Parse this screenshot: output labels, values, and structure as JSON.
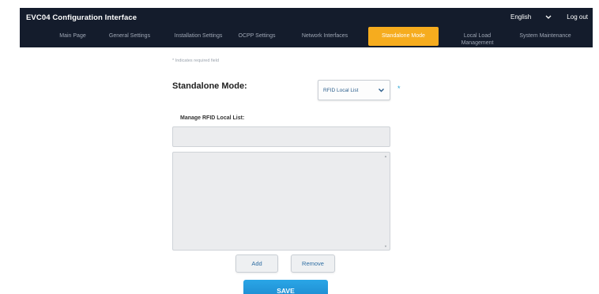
{
  "header": {
    "title": "EVC04 Configuration Interface",
    "language": "English",
    "logout_label": "Log out"
  },
  "nav": {
    "items": [
      {
        "label": "Main Page"
      },
      {
        "label": "General Settings"
      },
      {
        "label": "Installation Settings"
      },
      {
        "label": "OCPP Settings"
      },
      {
        "label": "Network Interfaces"
      },
      {
        "label": "Standalone Mode",
        "active": true
      },
      {
        "label_line1": "Local Load",
        "label_line2": "Management"
      },
      {
        "label": "System Maintenance"
      }
    ]
  },
  "form": {
    "required_note": "* Indicates required field",
    "mode_label": "Standalone Mode:",
    "mode_value": "RFID Local List",
    "required_marker": "*",
    "manage_label": "Manage RFID Local List:",
    "rfid_input_value": "",
    "add_label": "Add",
    "remove_label": "Remove",
    "save_label": "SAVE"
  },
  "colors": {
    "topbar_bg": "#141c2c",
    "active_tab": "#f6ac1e",
    "accent_blue": "#29a3d4",
    "save_button": "#1d8ad0"
  },
  "icons": {
    "language_dropdown": "chevron-down-icon",
    "mode_dropdown": "chevron-down-icon"
  }
}
